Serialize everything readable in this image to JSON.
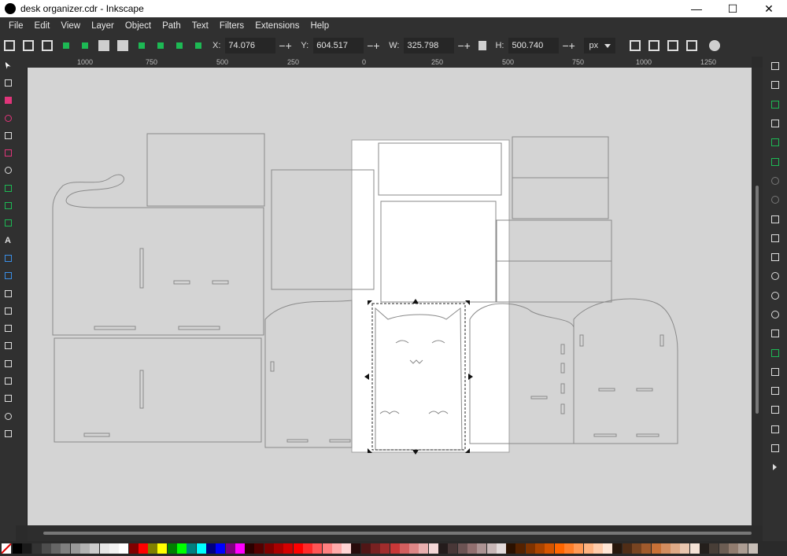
{
  "window": {
    "title": "desk organizer.cdr - Inkscape",
    "min": "—",
    "max": "☐",
    "close": "✕"
  },
  "menu": [
    "File",
    "Edit",
    "View",
    "Layer",
    "Object",
    "Path",
    "Text",
    "Filters",
    "Extensions",
    "Help"
  ],
  "toolbar": {
    "x_label": "X:",
    "x_value": "74.076",
    "y_label": "Y:",
    "y_value": "604.517",
    "w_label": "W:",
    "w_value": "325.798",
    "h_label": "H:",
    "h_value": "500.740",
    "unit": "px",
    "plusminus": "−+"
  },
  "ruler_ticks": [
    "1000",
    "750",
    "500",
    "250",
    "0",
    "250",
    "500",
    "750",
    "1000",
    "1250"
  ],
  "colors": {
    "canvas": "#d4d4d4",
    "page": "#ffffff",
    "accent": "#1db954"
  },
  "palette": [
    "#000000",
    "#1a1a1a",
    "#333333",
    "#4d4d4d",
    "#666666",
    "#808080",
    "#999999",
    "#b3b3b3",
    "#cccccc",
    "#e6e6e6",
    "#f2f2f2",
    "#ffffff",
    "#800000",
    "#ff0000",
    "#808000",
    "#ffff00",
    "#008000",
    "#00ff00",
    "#008080",
    "#00ffff",
    "#000080",
    "#0000ff",
    "#800080",
    "#ff00ff",
    "#2b0000",
    "#550000",
    "#800000",
    "#aa0000",
    "#d40000",
    "#ff0000",
    "#ff2a2a",
    "#ff5555",
    "#ff8080",
    "#ffaaaa",
    "#ffd5d5",
    "#280b0b",
    "#501616",
    "#782121",
    "#a02c2c",
    "#c83737",
    "#d35f5f",
    "#de8787",
    "#e9afaf",
    "#f4d7d7",
    "#241c1c",
    "#483737",
    "#6c5353",
    "#916f6f",
    "#ac9393",
    "#c8b7b7",
    "#e3dbdb",
    "#2b1100",
    "#552200",
    "#803300",
    "#aa4400",
    "#d45500",
    "#ff6600",
    "#ff7f2a",
    "#ff9955",
    "#ffb380",
    "#ffccaa",
    "#ffe6d5",
    "#28170b",
    "#502d16",
    "#784421",
    "#a05a2c",
    "#c87137",
    "#d38d5f",
    "#deaa87",
    "#e9c6af",
    "#f4e3d7",
    "#241f1c",
    "#483e37",
    "#6c5d53",
    "#917c6f",
    "#ac9d93",
    "#c8beb7"
  ]
}
